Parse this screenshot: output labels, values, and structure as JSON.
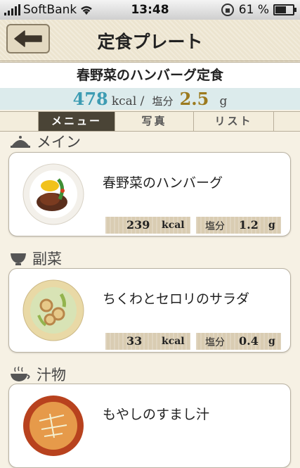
{
  "status": {
    "carrier": "SoftBank",
    "time": "13:48",
    "battery": "61 %",
    "battery_level": 0.61
  },
  "nav": {
    "title": "定食プレート",
    "back_icon": "arrow-left-icon"
  },
  "meal": {
    "title": "春野菜のハンバーグ定食",
    "kcal": "478",
    "kcal_unit": "kcal /",
    "salt_label": "塩分",
    "salt": "2.5",
    "salt_unit": "g"
  },
  "tabs": [
    {
      "label": "メニュー",
      "active": true
    },
    {
      "label": "写真",
      "active": false
    },
    {
      "label": "リスト",
      "active": false
    }
  ],
  "sections": [
    {
      "label": "メイン",
      "icon": "plate-cloche-icon",
      "dish": "春野菜のハンバーグ",
      "kcal": "239",
      "kcal_unit": "kcal",
      "salt_label": "塩分",
      "salt": "1.2",
      "salt_unit": "g"
    },
    {
      "label": "副菜",
      "icon": "bowl-icon",
      "dish": "ちくわとセロリのサラダ",
      "kcal": "33",
      "kcal_unit": "kcal",
      "salt_label": "塩分",
      "salt": "0.4",
      "salt_unit": "g"
    },
    {
      "label": "汁物",
      "icon": "soup-cup-icon",
      "dish": "もやしのすまし汁"
    }
  ]
}
